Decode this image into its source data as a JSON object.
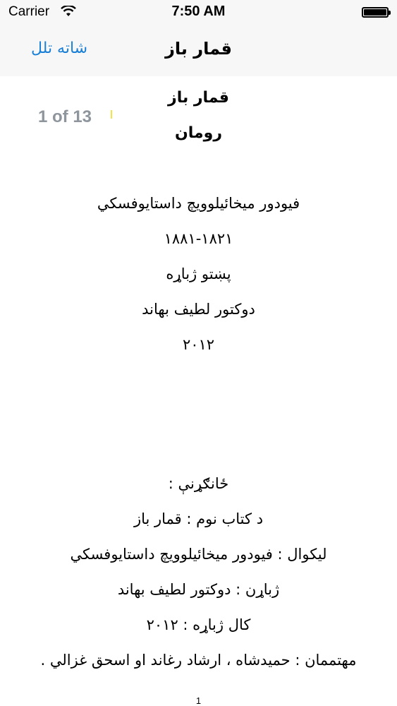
{
  "status_bar": {
    "carrier": "Carrier",
    "time": "7:50 AM"
  },
  "nav": {
    "back_label": "شاته تلل",
    "title": "قمار باز"
  },
  "page_indicator": "1 of 13",
  "content": {
    "title": "قمار باز",
    "subtitle": "رومان",
    "author": "فيودور ميخائيلوويچ داستايوفسکي",
    "years": "۱۸۸۱-۱۸۲۱",
    "translation_lang": "پښتو ژباړه",
    "translator": "دوکتور لطيف بهاند",
    "year": "۲۰۱۲",
    "info_heading": "ځانګړنې :",
    "book_name": "د کتاب نوم : قمار باز",
    "writer": "ليکوال : فيودور ميخائيلوويچ داستايوفسکي",
    "translator_line": "ژباړن : دوکتور لطيف بهاند",
    "translation_year": "کال ژباړه : ۲۰۱۲",
    "editors": "مهتممان : حميدشاه ، ارشاد رغاند او اسحق غزالي ."
  },
  "page_number": "1"
}
